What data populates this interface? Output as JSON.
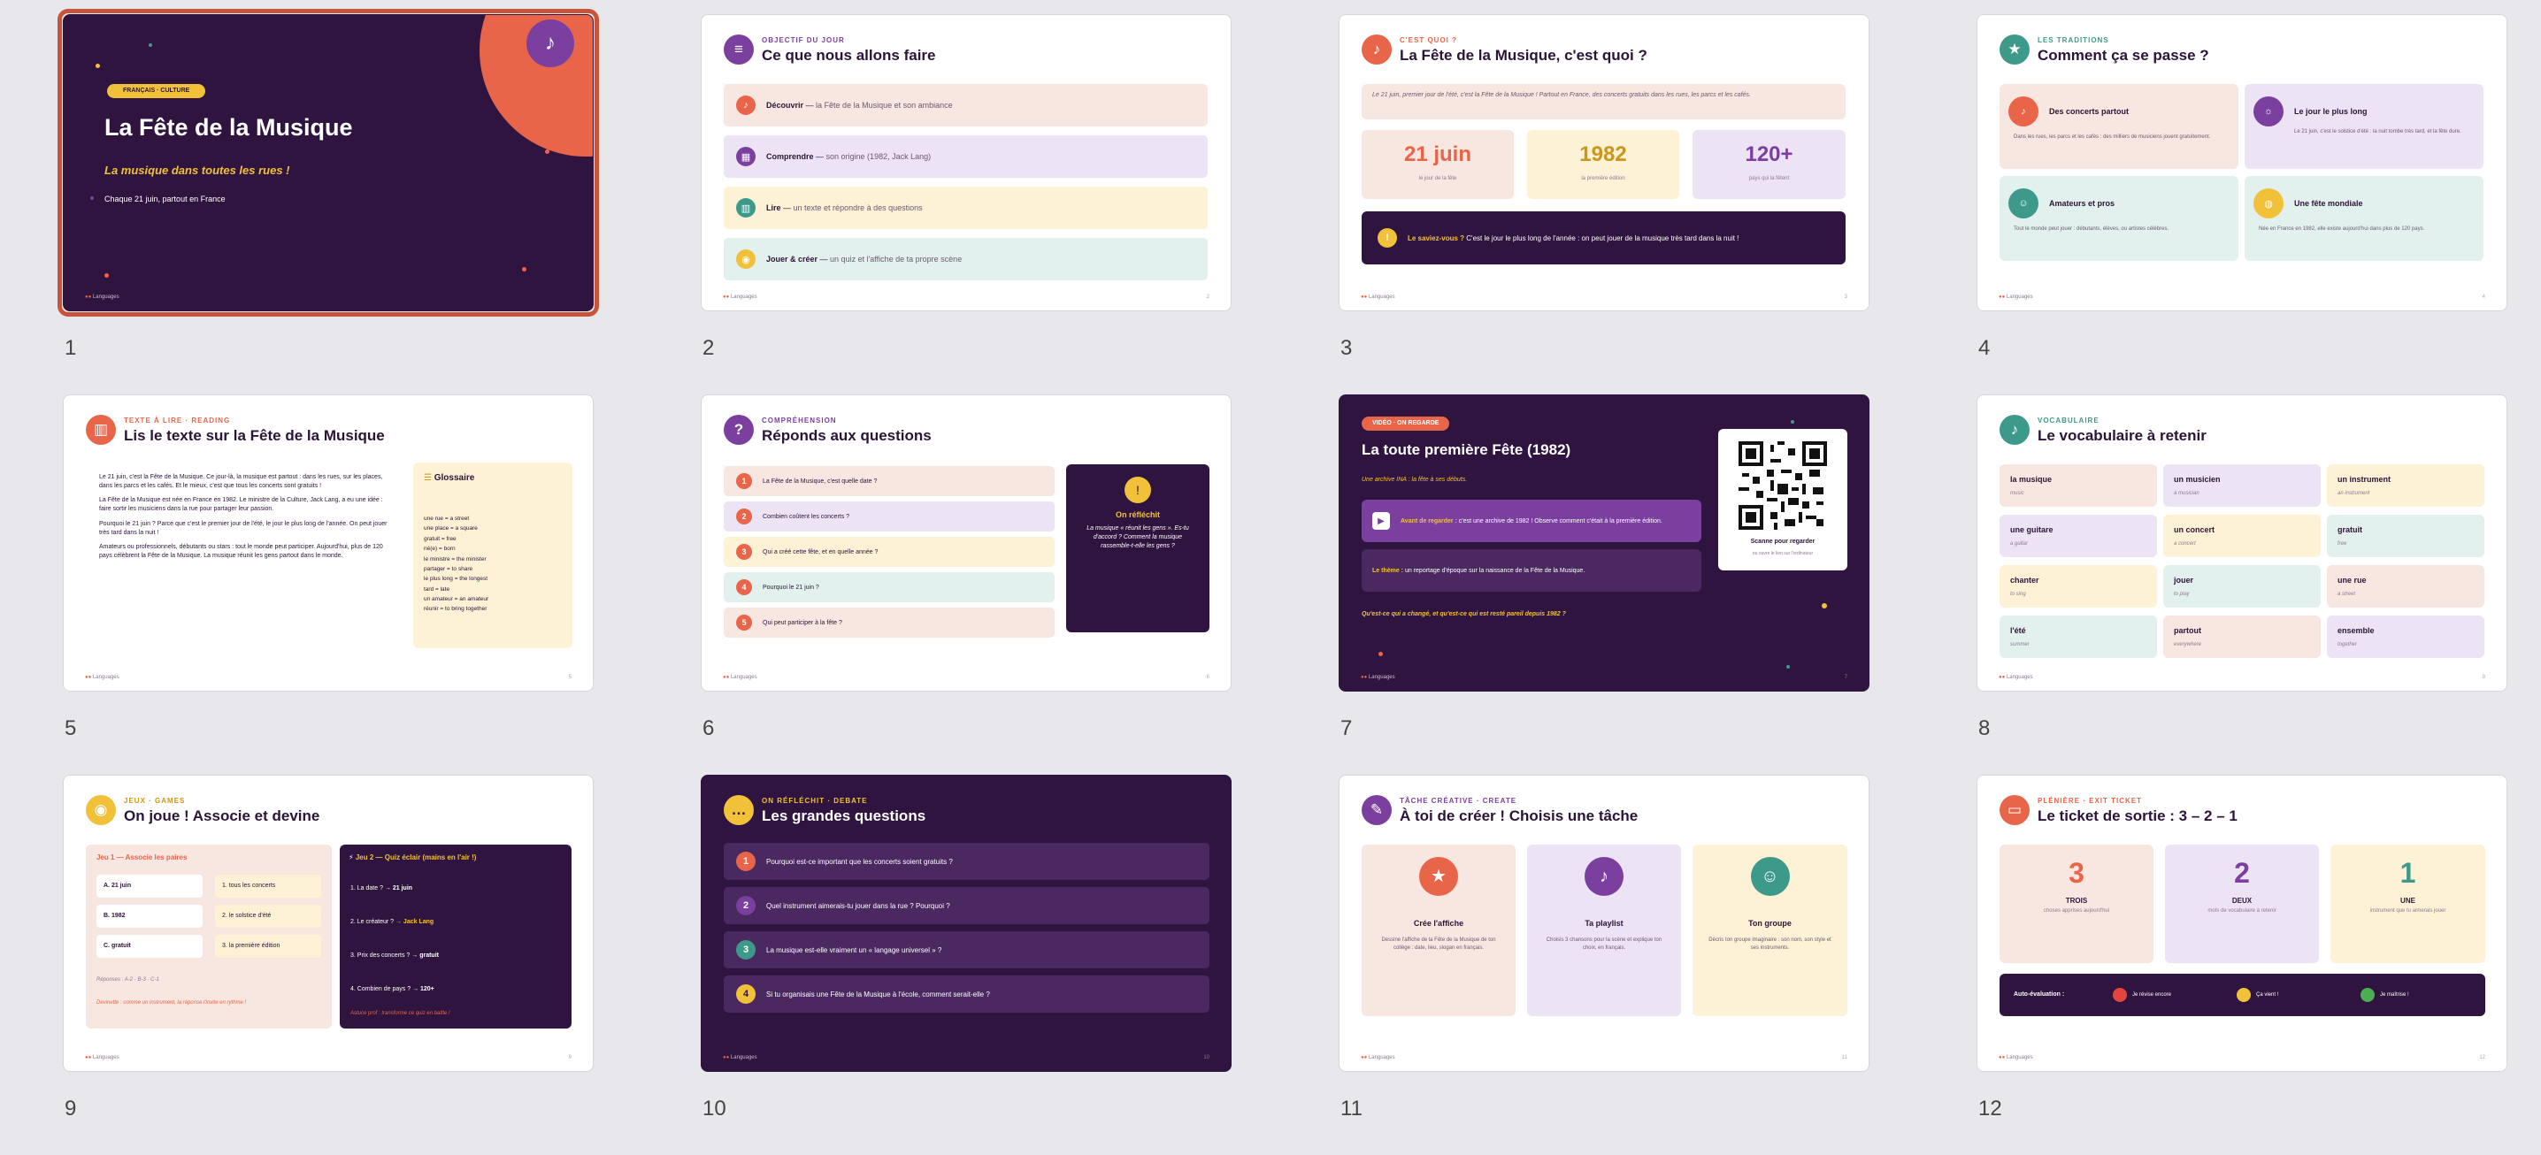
{
  "brand": "Languages",
  "slides": {
    "s1": {
      "num": "1",
      "badge": "FRANÇAIS · CULTURE",
      "title": "La Fête de la Musique",
      "subtitle": "La musique dans toutes les rues !",
      "date": "Chaque 21 juin, partout en France"
    },
    "s2": {
      "num": "2",
      "kicker": "OBJECTIF DU JOUR",
      "title": "Ce que nous allons faire",
      "page": "2",
      "items": [
        {
          "strong": "Découvrir",
          "rest": "la Fête de la Musique et son ambiance"
        },
        {
          "strong": "Comprendre",
          "rest": "son origine (1982, Jack Lang)"
        },
        {
          "strong": "Lire",
          "rest": "un texte et répondre à des questions"
        },
        {
          "strong": "Jouer & créer",
          "rest": "un quiz et l'affiche de ta propre scène"
        }
      ]
    },
    "s3": {
      "num": "3",
      "kicker": "C'EST QUOI ?",
      "title": "La Fête de la Musique, c'est quoi ?",
      "page": "3",
      "intro": "Le 21 juin, premier jour de l'été, c'est la Fête de la Musique ! Partout en France, des concerts gratuits dans les rues, les parcs et les cafés.",
      "stats": [
        {
          "value": "21 juin",
          "label": "le jour de la fête"
        },
        {
          "value": "1982",
          "label": "la première édition"
        },
        {
          "value": "120+",
          "label": "pays qui la fêtent"
        }
      ],
      "fact_strong": "Le saviez-vous ?",
      "fact": "C'est le jour le plus long de l'année : on peut jouer de la musique très tard dans la nuit !"
    },
    "s4": {
      "num": "4",
      "kicker": "LES TRADITIONS",
      "title": "Comment ça se passe ?",
      "page": "4",
      "cards": [
        {
          "title": "Des concerts partout",
          "text": "Dans les rues, les parcs et les cafés : des milliers de musiciens jouent gratuitement."
        },
        {
          "title": "Le jour le plus long",
          "text": "Le 21 juin, c'est le solstice d'été : la nuit tombe très tard, et la fête dure."
        },
        {
          "title": "Amateurs et pros",
          "text": "Tout le monde peut jouer : débutants, élèves, ou artistes célèbres."
        },
        {
          "title": "Une fête mondiale",
          "text": "Née en France en 1982, elle existe aujourd'hui dans plus de 120 pays."
        }
      ]
    },
    "s5": {
      "num": "5",
      "kicker": "TEXTE À LIRE · READING",
      "title": "Lis le texte sur la Fête de la Musique",
      "page": "5",
      "paragraphs": [
        "Le 21 juin, c'est la Fête de la Musique. Ce jour-là, la musique est partout : dans les rues, sur les places, dans les parcs et les cafés. Et le mieux, c'est que tous les concerts sont gratuits !",
        "La Fête de la Musique est née en France en 1982. Le ministre de la Culture, Jack Lang, a eu une idée : faire sortir les musiciens dans la rue pour partager leur passion.",
        "Pourquoi le 21 juin ? Parce que c'est le premier jour de l'été, le jour le plus long de l'année. On peut jouer très tard dans la nuit !",
        "Amateurs ou professionnels, débutants ou stars : tout le monde peut participer. Aujourd'hui, plus de 120 pays célèbrent la Fête de la Musique. La musique réunit les gens partout dans le monde."
      ],
      "glossary_title": "Glossaire",
      "glossary": [
        "une rue = a street",
        "une place = a square",
        "gratuit = free",
        "né(e) = born",
        "le ministre = the minister",
        "partager = to share",
        "le plus long = the longest",
        "tard = late",
        "un amateur = an amateur",
        "réunir = to bring together"
      ]
    },
    "s6": {
      "num": "6",
      "kicker": "COMPRÉHENSION",
      "title": "Réponds aux questions",
      "page": "6",
      "questions": [
        "La Fête de la Musique, c'est quelle date ?",
        "Combien coûtent les concerts ?",
        "Qui a créé cette fête, et en quelle année ?",
        "Pourquoi le 21 juin ?",
        "Qui peut participer à la fête ?"
      ],
      "side_title": "On réfléchit",
      "side_text": "La musique « réunit les gens ». Es-tu d'accord ? Comment la musique rassemble-t-elle les gens ?"
    },
    "s7": {
      "num": "7",
      "badge": "VIDÉO · ON REGARDE",
      "title": "La toute première Fête (1982)",
      "page": "7",
      "subtitle": "Une archive INA : la fête à ses débuts.",
      "box1_strong": "Avant de regarder :",
      "box1": "c'est une archive de 1982 ! Observe comment c'était à la première édition.",
      "box2_strong": "Le thème :",
      "box2": "un reportage d'époque sur la naissance de la Fête de la Musique.",
      "question": "Qu'est-ce qui a changé, et qu'est-ce qui est resté pareil depuis 1982 ?",
      "qr_label": "Scanne pour regarder",
      "qr_sub": "ou ouvre le lien sur l'ordinateur"
    },
    "s8": {
      "num": "8",
      "kicker": "VOCABULAIRE",
      "title": "Le vocabulaire à retenir",
      "page": "8",
      "words": [
        {
          "fr": "la musique",
          "en": "music"
        },
        {
          "fr": "un musicien",
          "en": "a musician"
        },
        {
          "fr": "un instrument",
          "en": "an instrument"
        },
        {
          "fr": "une guitare",
          "en": "a guitar"
        },
        {
          "fr": "un concert",
          "en": "a concert"
        },
        {
          "fr": "gratuit",
          "en": "free"
        },
        {
          "fr": "chanter",
          "en": "to sing"
        },
        {
          "fr": "jouer",
          "en": "to play"
        },
        {
          "fr": "une rue",
          "en": "a street"
        },
        {
          "fr": "l'été",
          "en": "summer"
        },
        {
          "fr": "partout",
          "en": "everywhere"
        },
        {
          "fr": "ensemble",
          "en": "together"
        }
      ]
    },
    "s9": {
      "num": "9",
      "kicker": "JEUX · GAMES",
      "title": "On joue ! Associe et devine",
      "page": "9",
      "game1_title": "Jeu 1 — Associe les paires",
      "left": [
        "A.  21 juin",
        "B.  1982",
        "C.  gratuit"
      ],
      "right": [
        "1.  tous les concerts",
        "2.  le solstice d'été",
        "3.  la première édition"
      ],
      "answers": "Réponses : A-2 · B-3 · C-1",
      "bonus": "Devinette : comme un instrument, la réponse l'invite en rythme !",
      "game2_title": "Jeu 2 — Quiz éclair (mains en l'air !)",
      "quiz": [
        {
          "q": "1.  La date ?",
          "a": "→ 21 juin"
        },
        {
          "q": "2.  Le créateur ?",
          "a": "→ Jack Lang"
        },
        {
          "q": "3.  Prix des concerts ?",
          "a": "→ gratuit"
        },
        {
          "q": "4.  Combien de pays ?",
          "a": "→ 120+"
        }
      ],
      "quiz_note": "Astuce prof : transforme ce quiz en battle !"
    },
    "s10": {
      "num": "10",
      "kicker": "ON RÉFLÉCHIT · DEBATE",
      "title": "Les grandes questions",
      "page": "10",
      "questions": [
        "Pourquoi est-ce important que les concerts soient gratuits ?",
        "Quel instrument aimerais-tu jouer dans la rue ? Pourquoi ?",
        "La musique est-elle vraiment un « langage universel » ?",
        "Si tu organisais une Fête de la Musique à l'école, comment serait-elle ?"
      ]
    },
    "s11": {
      "num": "11",
      "kicker": "TÂCHE CRÉATIVE · CREATE",
      "title": "À toi de créer ! Choisis une tâche",
      "page": "11",
      "tasks": [
        {
          "title": "Crée l'affiche",
          "text": "Dessine l'affiche de la Fête de la Musique de ton collège : date, lieu, slogan en français."
        },
        {
          "title": "Ta playlist",
          "text": "Choisis 3 chansons pour la scène et explique ton choix, en français."
        },
        {
          "title": "Ton groupe",
          "text": "Décris ton groupe imaginaire : son nom, son style et ses instruments."
        }
      ]
    },
    "s12": {
      "num": "12",
      "kicker": "PLÉNIÈRE · EXIT TICKET",
      "title": "Le ticket de sortie : 3 – 2 – 1",
      "page": "12",
      "tickets": [
        {
          "n": "3",
          "word": "TROIS",
          "text": "choses apprises aujourd'hui"
        },
        {
          "n": "2",
          "word": "DEUX",
          "text": "mots de vocabulaire à retenir"
        },
        {
          "n": "1",
          "word": "UNE",
          "text": "instrument que tu aimerais jouer"
        }
      ],
      "self_label": "Auto-évaluation :",
      "levels": [
        "Je révise encore",
        "Ça vient !",
        "Je maîtrise !"
      ]
    }
  }
}
